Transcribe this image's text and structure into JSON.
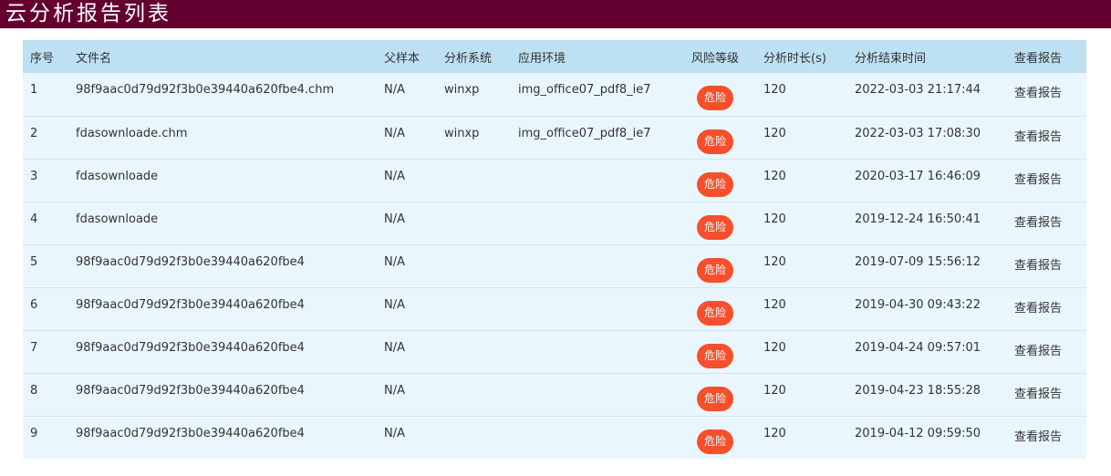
{
  "page": {
    "title": "云分析报告列表"
  },
  "table": {
    "headers": {
      "index": "序号",
      "filename": "文件名",
      "parent": "父样本",
      "system": "分析系统",
      "env": "应用环境",
      "risk": "风险等级",
      "duration": "分析时长(s)",
      "end_time": "分析结束时间",
      "report": "查看报告"
    },
    "rows": [
      {
        "index": "1",
        "filename": "98f9aac0d79d92f3b0e39440a620fbe4.chm",
        "parent": "N/A",
        "system": "winxp",
        "env": "img_office07_pdf8_ie7",
        "risk": "危险",
        "duration": "120",
        "end_time": "2022-03-03 21:17:44",
        "report": "查看报告"
      },
      {
        "index": "2",
        "filename": "fdasownloade.chm",
        "parent": "N/A",
        "system": "winxp",
        "env": "img_office07_pdf8_ie7",
        "risk": "危险",
        "duration": "120",
        "end_time": "2022-03-03 17:08:30",
        "report": "查看报告"
      },
      {
        "index": "3",
        "filename": "fdasownloade",
        "parent": "N/A",
        "system": "",
        "env": "",
        "risk": "危险",
        "duration": "120",
        "end_time": "2020-03-17 16:46:09",
        "report": "查看报告"
      },
      {
        "index": "4",
        "filename": "fdasownloade",
        "parent": "N/A",
        "system": "",
        "env": "",
        "risk": "危险",
        "duration": "120",
        "end_time": "2019-12-24 16:50:41",
        "report": "查看报告"
      },
      {
        "index": "5",
        "filename": "98f9aac0d79d92f3b0e39440a620fbe4",
        "parent": "N/A",
        "system": "",
        "env": "",
        "risk": "危险",
        "duration": "120",
        "end_time": "2019-07-09 15:56:12",
        "report": "查看报告"
      },
      {
        "index": "6",
        "filename": "98f9aac0d79d92f3b0e39440a620fbe4",
        "parent": "N/A",
        "system": "",
        "env": "",
        "risk": "危险",
        "duration": "120",
        "end_time": "2019-04-30 09:43:22",
        "report": "查看报告"
      },
      {
        "index": "7",
        "filename": "98f9aac0d79d92f3b0e39440a620fbe4",
        "parent": "N/A",
        "system": "",
        "env": "",
        "risk": "危险",
        "duration": "120",
        "end_time": "2019-04-24 09:57:01",
        "report": "查看报告"
      },
      {
        "index": "8",
        "filename": "98f9aac0d79d92f3b0e39440a620fbe4",
        "parent": "N/A",
        "system": "",
        "env": "",
        "risk": "危险",
        "duration": "120",
        "end_time": "2019-04-23 18:55:28",
        "report": "查看报告"
      },
      {
        "index": "9",
        "filename": "98f9aac0d79d92f3b0e39440a620fbe4",
        "parent": "N/A",
        "system": "",
        "env": "",
        "risk": "危险",
        "duration": "120",
        "end_time": "2019-04-12 09:59:50",
        "report": "查看报告"
      }
    ]
  },
  "colors": {
    "title_bar": "#640030",
    "header_bg": "#bde0f2",
    "row_bg": "#eaf6fd",
    "risk_badge": "#f74f2b"
  }
}
